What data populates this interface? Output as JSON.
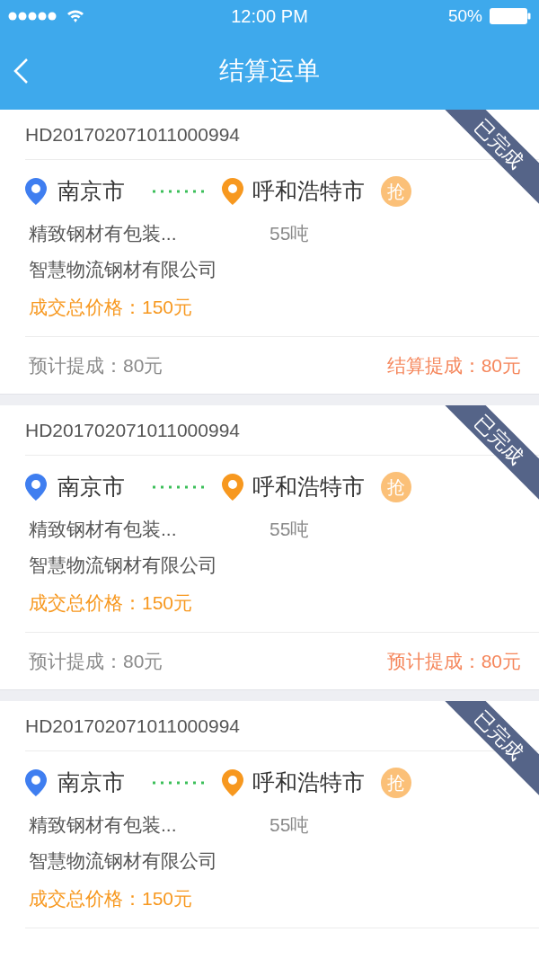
{
  "status_bar": {
    "time": "12:00 PM",
    "battery": "50%"
  },
  "nav": {
    "title": "结算运单"
  },
  "orders": [
    {
      "order_no": "HD201702071011000994",
      "status": "已完成",
      "origin": "南京市",
      "destination": "呼和浩特市",
      "grab_badge": "抢",
      "goods": "精致钢材有包装...",
      "weight": "55吨",
      "company": "智慧物流钢材有限公司",
      "deal_price": "成交总价格：150元",
      "estimated": "预计提成：80元",
      "settlement": "结算提成：80元"
    },
    {
      "order_no": "HD201702071011000994",
      "status": "已完成",
      "origin": "南京市",
      "destination": "呼和浩特市",
      "grab_badge": "抢",
      "goods": "精致钢材有包装...",
      "weight": "55吨",
      "company": "智慧物流钢材有限公司",
      "deal_price": "成交总价格：150元",
      "estimated": "预计提成：80元",
      "settlement": "预计提成：80元"
    },
    {
      "order_no": "HD201702071011000994",
      "status": "已完成",
      "origin": "南京市",
      "destination": "呼和浩特市",
      "grab_badge": "抢",
      "goods": "精致钢材有包装...",
      "weight": "55吨",
      "company": "智慧物流钢材有限公司",
      "deal_price": "成交总价格：150元"
    }
  ]
}
